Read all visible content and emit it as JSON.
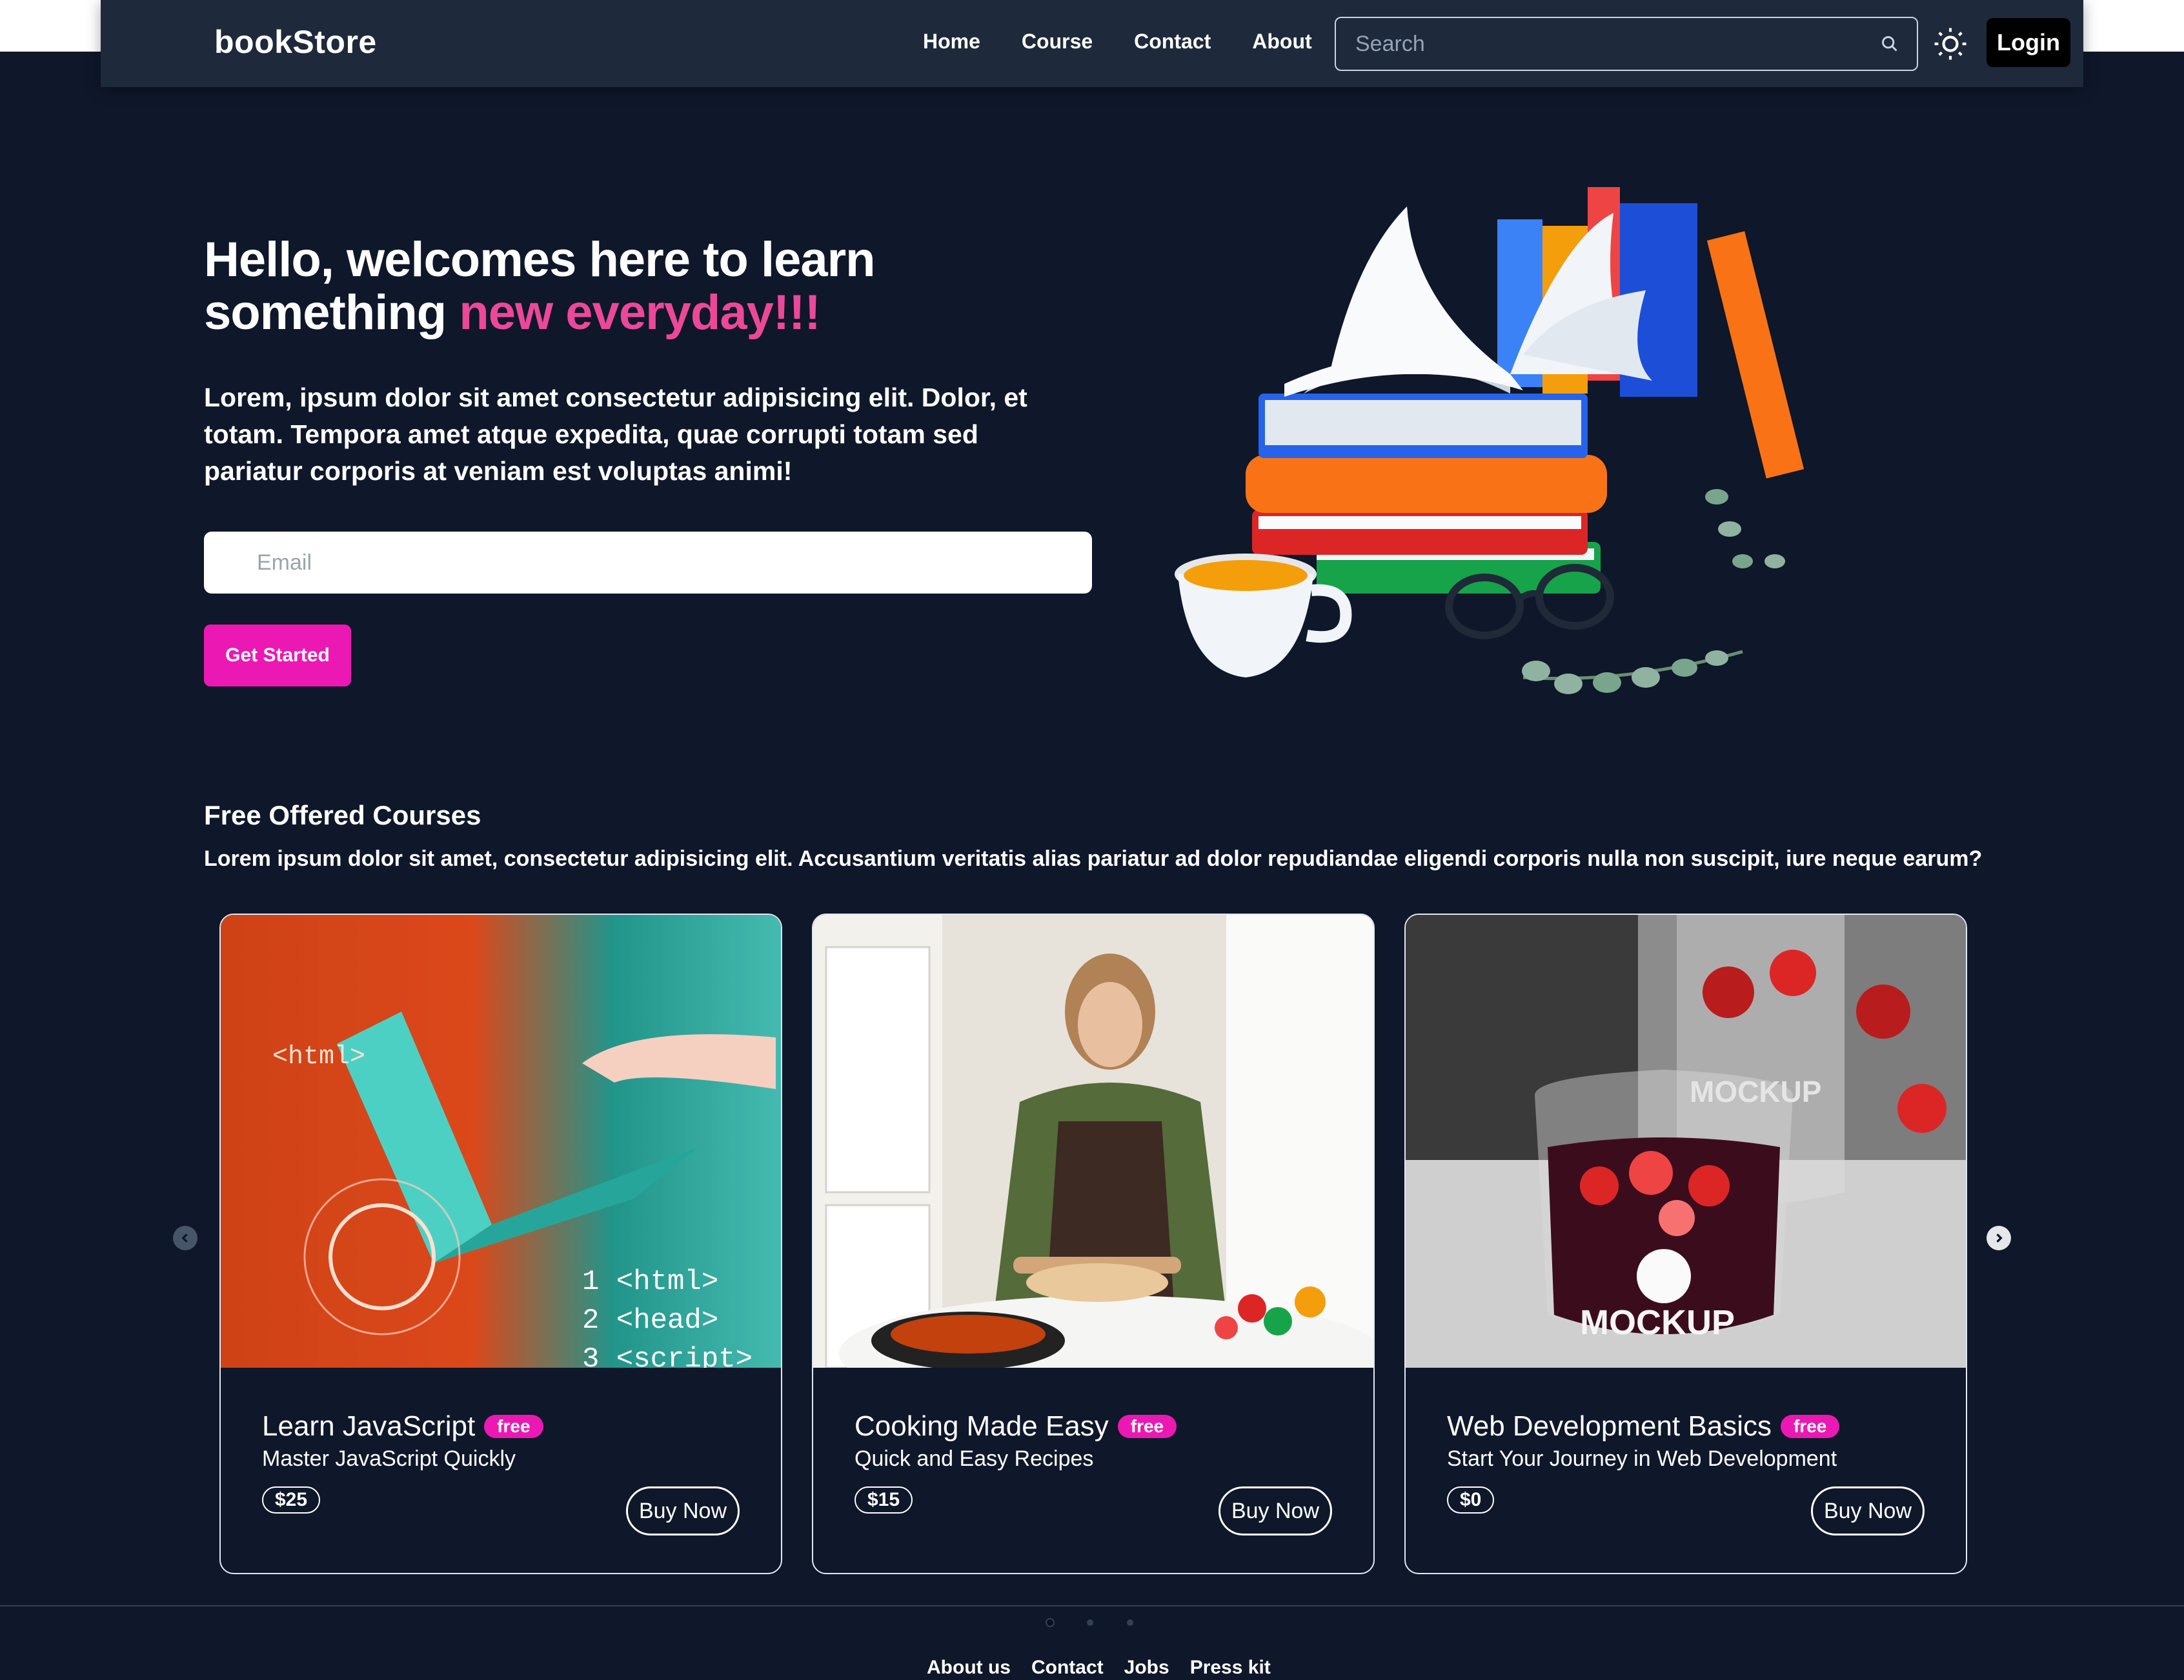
{
  "brand": "bookStore",
  "nav": {
    "links": [
      "Home",
      "Course",
      "Contact",
      "About"
    ],
    "search_placeholder": "Search",
    "login_label": "Login"
  },
  "hero": {
    "title_line1": "Hello, welcomes here to learn",
    "title_line2_plain": "something ",
    "title_line2_accent": "new everyday!!!",
    "description": "Lorem, ipsum dolor sit amet consectetur adipisicing elit. Dolor, et totam. Tempora amet atque expedita, quae corrupti totam sed pariatur corporis at veniam est voluptas animi!",
    "email_placeholder": "Email",
    "cta_label": "Get Started"
  },
  "courses": {
    "title": "Free Offered Courses",
    "description": "Lorem ipsum dolor sit amet, consectetur adipisicing elit. Accusantium veritatis alias pariatur ad dolor repudiandae eligendi corporis nulla non suscipit, iure neque earum?",
    "items": [
      {
        "title": "Learn JavaScript",
        "badge": "free",
        "subtitle": "Master JavaScript Quickly",
        "price": "$25",
        "button": "Buy Now"
      },
      {
        "title": "Cooking Made Easy",
        "badge": "free",
        "subtitle": "Quick and Easy Recipes",
        "price": "$15",
        "button": "Buy Now"
      },
      {
        "title": "Web Development Basics",
        "badge": "free",
        "subtitle": "Start Your Journey in Web Development",
        "price": "$0",
        "button": "Buy Now"
      }
    ],
    "image_text": {
      "code": [
        "<html>",
        "1 <html>",
        "2 <head>",
        "3 <script>"
      ],
      "mockup": [
        "MOCKUP",
        "MOCKUP"
      ]
    }
  },
  "footer": {
    "links": [
      "About us",
      "Contact",
      "Jobs",
      "Press kit"
    ]
  },
  "colors": {
    "background": "#0f172a",
    "navbar": "#1e293b",
    "accent_pink": "#ec4899",
    "button_pink": "#ec18b4"
  }
}
